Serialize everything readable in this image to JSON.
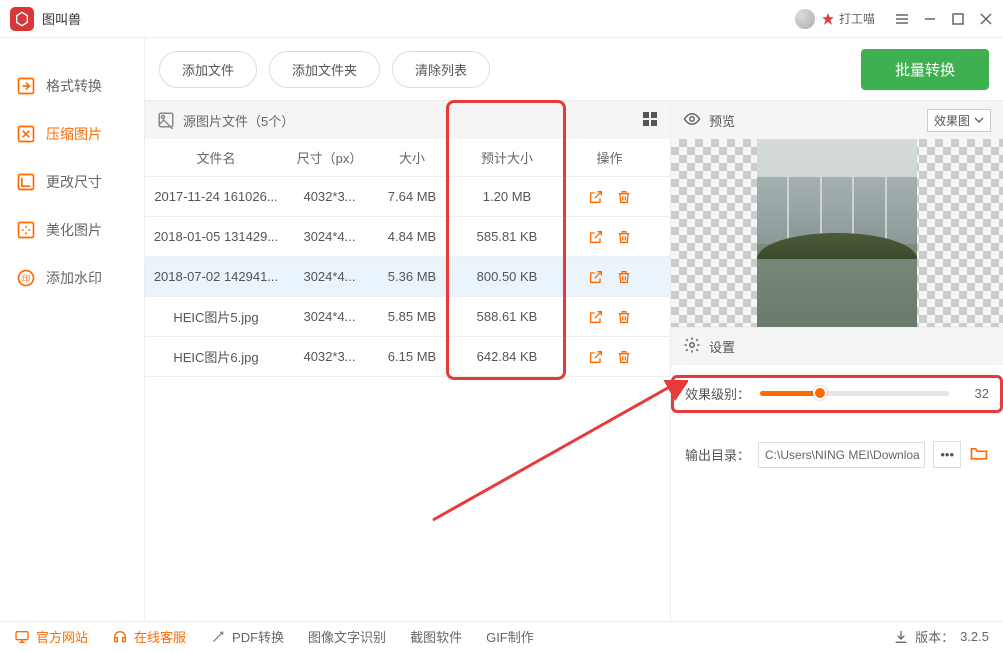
{
  "app": {
    "title": "图叫兽"
  },
  "user": {
    "name": "打工喵"
  },
  "sidebar": {
    "items": [
      {
        "label": "格式转换"
      },
      {
        "label": "压缩图片"
      },
      {
        "label": "更改尺寸"
      },
      {
        "label": "美化图片"
      },
      {
        "label": "添加水印"
      }
    ]
  },
  "toolbar": {
    "add_file": "添加文件",
    "add_folder": "添加文件夹",
    "clear_list": "清除列表",
    "batch_convert": "批量转换"
  },
  "filelist": {
    "header": "源图片文件（5个）",
    "columns": {
      "name": "文件名",
      "size": "尺寸（px）",
      "bytes": "大小",
      "est": "预计大小",
      "ops": "操作"
    },
    "rows": [
      {
        "name": "2017-11-24 161026...",
        "size": "4032*3...",
        "bytes": "7.64 MB",
        "est": "1.20 MB"
      },
      {
        "name": "2018-01-05 131429...",
        "size": "3024*4...",
        "bytes": "4.84 MB",
        "est": "585.81 KB"
      },
      {
        "name": "2018-07-02 142941...",
        "size": "3024*4...",
        "bytes": "5.36 MB",
        "est": "800.50 KB"
      },
      {
        "name": "HEIC图片5.jpg",
        "size": "3024*4...",
        "bytes": "5.85 MB",
        "est": "588.61 KB"
      },
      {
        "name": "HEIC图片6.jpg",
        "size": "4032*3...",
        "bytes": "6.15 MB",
        "est": "642.84 KB"
      }
    ]
  },
  "preview": {
    "label": "预览",
    "mode": "效果图"
  },
  "settings": {
    "label": "设置",
    "quality_label": "效果级别：",
    "quality_value": "32",
    "output_label": "输出目录：",
    "output_path": "C:\\Users\\NING MEI\\Downloa",
    "more": "•••"
  },
  "statusbar": {
    "website": "官方网站",
    "support": "在线客服",
    "pdf": "PDF转换",
    "ocr": "图像文字识别",
    "screenshot": "截图软件",
    "gif": "GIF制作",
    "version_label": "版本：",
    "version": "3.2.5"
  }
}
